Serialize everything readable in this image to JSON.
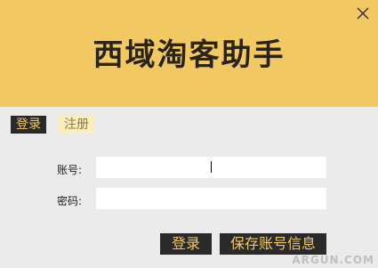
{
  "header": {
    "title": "西域淘客助手"
  },
  "tabs": {
    "login": "登录",
    "register": "注册"
  },
  "form": {
    "account_label": "账号:",
    "password_label": "密码:",
    "account_value": "",
    "password_value": ""
  },
  "buttons": {
    "login": "登录",
    "save": "保存账号信息"
  },
  "watermark": "ARGUN.COM",
  "colors": {
    "accent": "#f2c863",
    "dark": "#2a2a2a",
    "panel": "#ebebeb"
  }
}
